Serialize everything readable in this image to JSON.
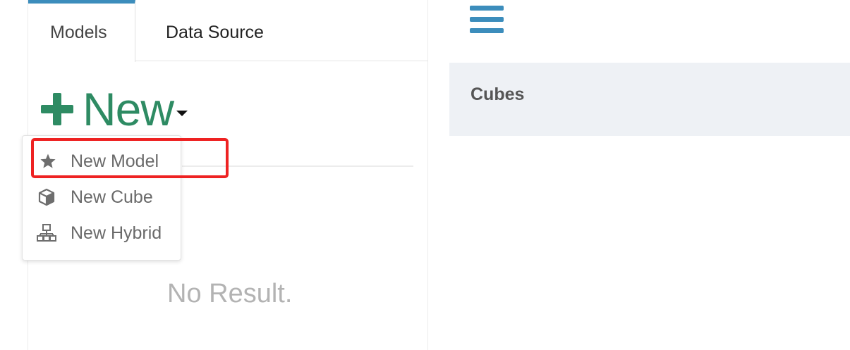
{
  "tabs": {
    "models": "Models",
    "data_source": "Data Source"
  },
  "new_button": {
    "label": "New"
  },
  "dropdown": {
    "items": [
      {
        "label": "New Model",
        "icon": "star-icon"
      },
      {
        "label": "New Cube",
        "icon": "cube-icon"
      },
      {
        "label": "New Hybrid",
        "icon": "sitemap-icon"
      }
    ]
  },
  "empty_state": "No Result.",
  "cubes_panel": {
    "title": "Cubes"
  },
  "colors": {
    "accent_blue": "#3c8dbc",
    "new_green": "#2e8b63",
    "highlight_red": "#ee2222",
    "panel_bg": "#eef1f5"
  }
}
